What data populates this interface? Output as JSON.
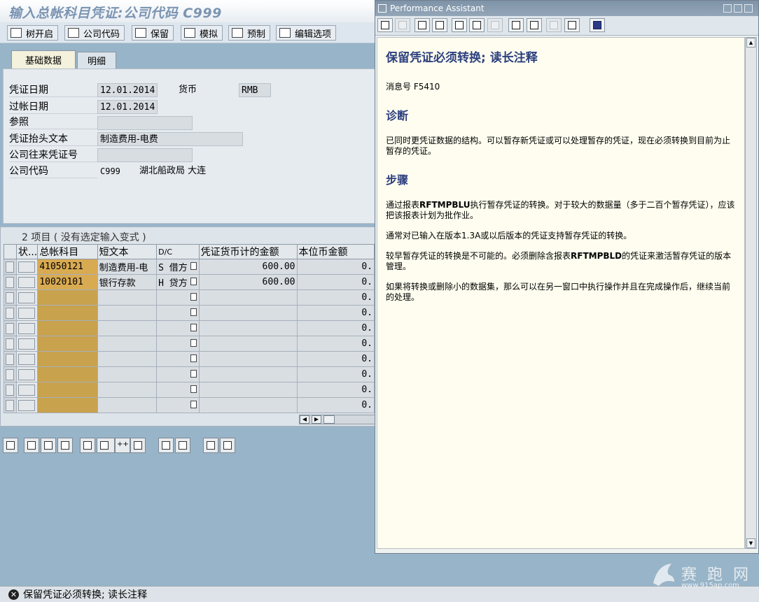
{
  "window": {
    "title": "输入总帐科目凭证:公司代码 C999"
  },
  "toolbar": {
    "tree_label": "树开启",
    "company_code_label": "公司代码",
    "hold_label": "保留",
    "simulate_label": "模拟",
    "park_label": "预制",
    "edit_options_label": "编辑选项"
  },
  "tabs": {
    "basic": "基础数据",
    "detail": "明细"
  },
  "header": {
    "doc_date_label": "凭证日期",
    "doc_date": "12.01.2014",
    "currency_label": "货币",
    "currency": "RMB",
    "post_date_label": "过帐日期",
    "post_date": "12.01.2014",
    "reference_label": "参照",
    "reference": "",
    "header_text_label": "凭证抬头文本",
    "header_text": "制造费用-电费",
    "ic_doc_label": "公司往来凭证号",
    "ic_doc": "",
    "company_code_label": "公司代码",
    "company_code": "C999",
    "company_name": "湖北船政局 大连"
  },
  "items": {
    "title": "2 项目 ( 没有选定输入变式 )",
    "columns": {
      "status": "状...",
      "gl_account": "总帐科目",
      "short_text": "短文本",
      "dc": "D/C",
      "doc_amount": "凭证货币计的金额",
      "local_amount": "本位币金额"
    },
    "rows": [
      {
        "gl": "41050121",
        "text": "制造费用-电",
        "dc": "S 借方",
        "amount": "600.00",
        "local": "0."
      },
      {
        "gl": "10020101",
        "text": "银行存款",
        "dc": "H 贷方",
        "amount": "600.00",
        "local": "0."
      },
      {
        "gl": "",
        "text": "",
        "dc": "",
        "amount": "",
        "local": "0."
      },
      {
        "gl": "",
        "text": "",
        "dc": "",
        "amount": "",
        "local": "0."
      },
      {
        "gl": "",
        "text": "",
        "dc": "",
        "amount": "",
        "local": "0."
      },
      {
        "gl": "",
        "text": "",
        "dc": "",
        "amount": "",
        "local": "0."
      },
      {
        "gl": "",
        "text": "",
        "dc": "",
        "amount": "",
        "local": "0."
      },
      {
        "gl": "",
        "text": "",
        "dc": "",
        "amount": "",
        "local": "0."
      },
      {
        "gl": "",
        "text": "",
        "dc": "",
        "amount": "",
        "local": "0."
      },
      {
        "gl": "",
        "text": "",
        "dc": "",
        "amount": "",
        "local": "0."
      }
    ]
  },
  "status_bar": {
    "message": "保留凭证必须转换; 读长注释"
  },
  "assistant": {
    "window_title": "Performance Assistant",
    "heading": "保留凭证必须转换; 读长注释",
    "message_no_label": "消息号",
    "message_no": "F5410",
    "diagnosis_title": "诊断",
    "diagnosis_text": "已同时更凭证数据的结构。可以暂存新凭证或可以处理暂存的凭证，现在必须转换到目前为止暂存的凭证。",
    "procedure_title": "步骤",
    "p1_a": "通过报表",
    "p1_b": "RFTMPBLU",
    "p1_c": "执行暂存凭证的转换。对于较大的数据量（多于二百个暂存凭证），应该把该报表计划为批作业。",
    "p2": "通常对已输入在版本1.3A或以后版本的凭证支持暂存凭证的转换。",
    "p3_a": "较早暂存凭证的转换是不可能的。必须删除含报表",
    "p3_b": "RFTMPBLD",
    "p3_c": "的凭证来激活暂存凭证的版本管理。",
    "p4": "如果将转换或删除小的数据集，那么可以在另一窗口中执行操作并且在完成操作后，继续当前的处理。"
  },
  "watermark": {
    "text": "赛 跑 网",
    "url": "www.915ap.com"
  }
}
